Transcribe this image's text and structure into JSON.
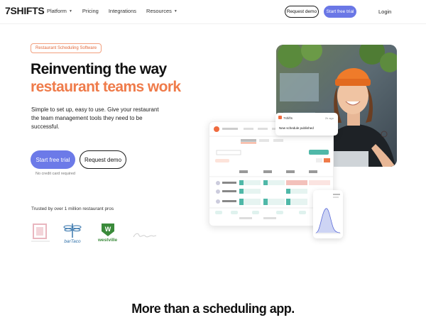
{
  "nav": {
    "logo": "7SHIFTS",
    "links": [
      "Platform",
      "Pricing",
      "Integrations",
      "Resources"
    ],
    "request_demo": "Request demo",
    "start_trial": "Start free trial",
    "login": "Login"
  },
  "hero": {
    "pill": "Restaurant Scheduling Software",
    "title_line1": "Reinventing the way",
    "title_line2": "restaurant teams work",
    "subtitle": "Simple to set up, easy to use. Give your restaurant the team management tools they need to be successful.",
    "cta_trial": "Start free trial",
    "cta_demo": "Request demo",
    "no_card": "No credit card required",
    "trusted": "Trusted by over 1 million restaurant pros"
  },
  "brands": [
    "barTaco",
    "westville"
  ],
  "notification": {
    "app": "7shifts",
    "time": "2h ago",
    "text": "New schedule published"
  },
  "schedule": {
    "view_label": "View Schedule",
    "days": [
      "Sun",
      "Mon",
      "Tue",
      "Wed"
    ],
    "employees": [
      "Olivia Fernet",
      "Alexandra Ponder",
      "John Morrison"
    ]
  },
  "footer_heading": "More than a scheduling app.",
  "colors": {
    "accent_orange": "#ef7b4a",
    "accent_purple": "#6c7ae8",
    "schedule_teal": "#4fb8a8",
    "schedule_pink": "#f3c1bb"
  }
}
